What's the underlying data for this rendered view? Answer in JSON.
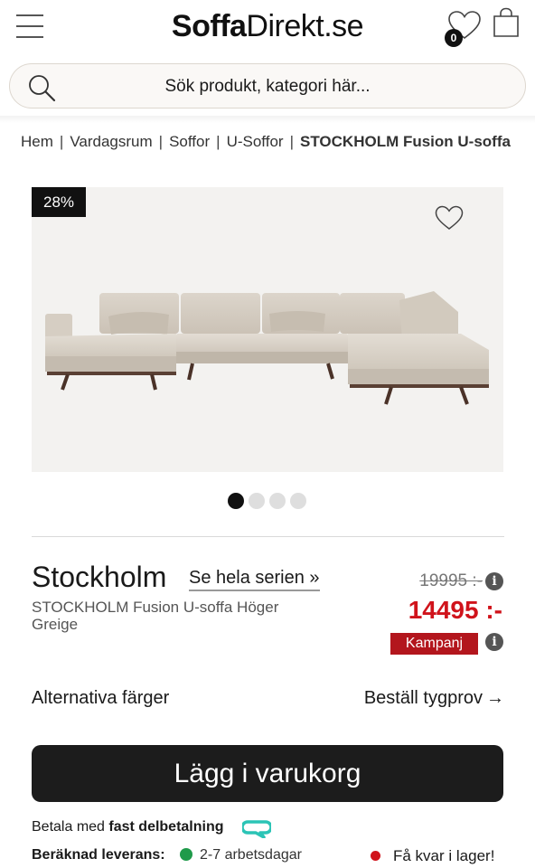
{
  "header": {
    "logo_bold": "Soffa",
    "logo_light": "Direkt.se",
    "wishlist_count": "0"
  },
  "search": {
    "placeholder": "Sök produkt, kategori här..."
  },
  "breadcrumb": {
    "items": [
      "Hem",
      "Vardagsrum",
      "Soffor",
      "U-Soffor"
    ],
    "separator": "|",
    "current": "STOCKHOLM Fusion U-soffa Höger Greige"
  },
  "gallery": {
    "discount_badge": "28%",
    "image_count": 4,
    "active_index": 0
  },
  "product": {
    "name": "Stockholm",
    "series_link": "Se hela serien »",
    "subtitle": "STOCKHOLM Fusion U-soffa Höger Greige",
    "old_price": "19995 :-",
    "new_price": "14495 :-",
    "campaign_label": "Kampanj",
    "info_symbol": "i"
  },
  "options": {
    "alt_colors": "Alternativa färger",
    "fabric_sample": "Beställ tygprov",
    "fabric_arrow": "→"
  },
  "cart": {
    "add_button": "Lägg i varukorg"
  },
  "payment": {
    "prefix": "Betala med ",
    "bold": "fast delbetalning"
  },
  "delivery": {
    "label": "Beräknad leverans:",
    "value": "2-7 arbetsdagar",
    "stock": "Få kvar i lager!"
  },
  "colors": {
    "price_red": "#d0131b",
    "campaign_red": "#b3161d",
    "button_dark": "#1c1c1c",
    "delivery_green": "#1f9a4a",
    "klarna_teal": "#2bc4b6"
  }
}
